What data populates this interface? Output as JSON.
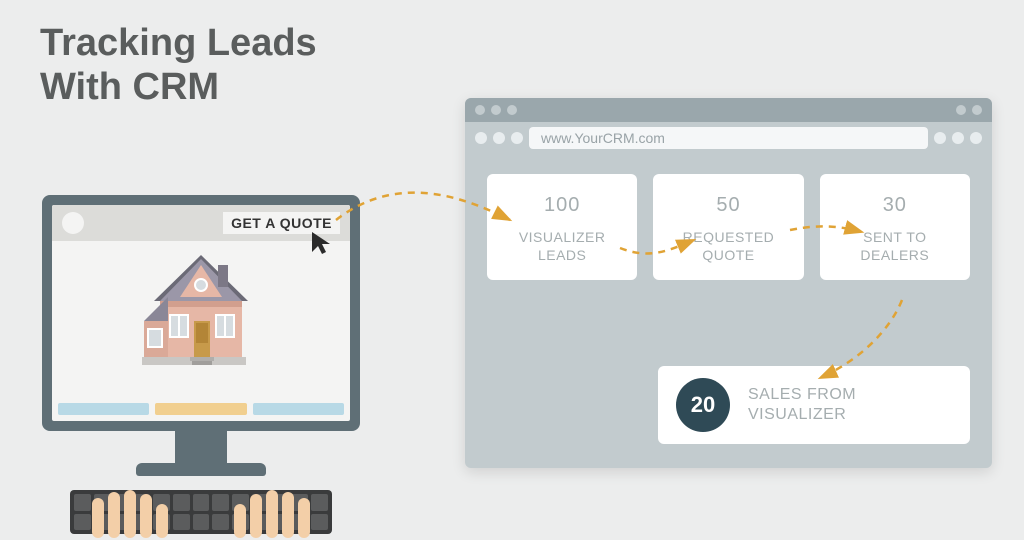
{
  "title_line1": "Tracking Leads",
  "title_line2": "With CRM",
  "visualizer": {
    "cta": "GET A QUOTE"
  },
  "browser": {
    "url": "www.YourCRM.com"
  },
  "cards": [
    {
      "value": "100",
      "label_l1": "VISUALIZER",
      "label_l2": "LEADS"
    },
    {
      "value": "50",
      "label_l1": "REQUESTED",
      "label_l2": "QUOTE"
    },
    {
      "value": "30",
      "label_l1": "SENT TO",
      "label_l2": "DEALERS"
    }
  ],
  "sales": {
    "value": "20",
    "label_l1": "SALES FROM",
    "label_l2": "VISUALIZER"
  },
  "colors": {
    "accent_dark": "#2f4a56",
    "arrow": "#e0a335"
  }
}
